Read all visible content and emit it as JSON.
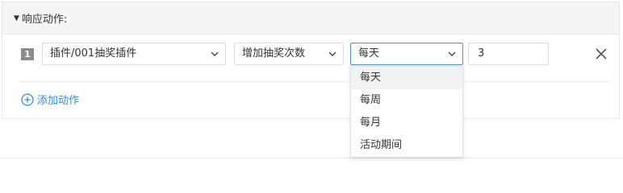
{
  "section": {
    "title": "响应动作:"
  },
  "action_row": {
    "index": "1",
    "plugin_select": "插件/001抽奖插件",
    "operation_select": "增加抽奖次数",
    "period_select": "每天",
    "count_value": "3"
  },
  "add_action": {
    "label": "添加动作"
  },
  "period_dropdown": {
    "options": [
      "每天",
      "每周",
      "每月",
      "活动期间"
    ],
    "highlighted": "每天"
  },
  "colors": {
    "accent": "#2d8cf0",
    "active_border": "#4d90d6",
    "header_bg": "#f5f5f5",
    "index_badge": "#8c8c8c"
  }
}
